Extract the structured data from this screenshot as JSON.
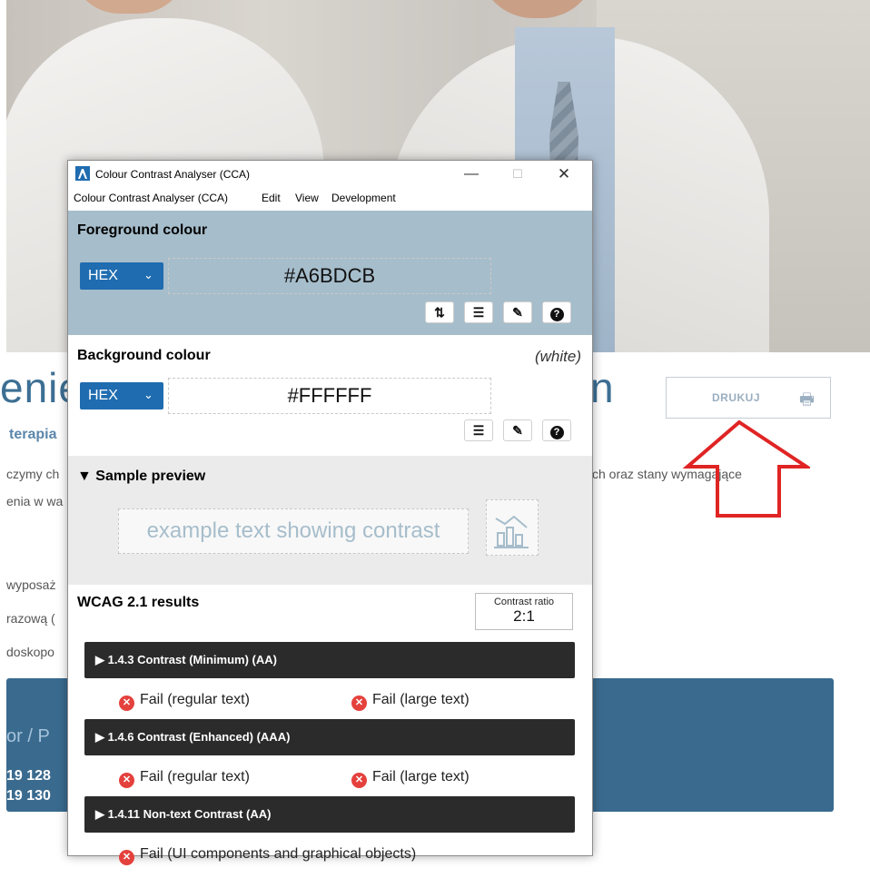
{
  "page": {
    "title_left": "enie",
    "title_right": "n",
    "subtitle": "terapia",
    "lines": [
      "czymy ch",
      "enia w wa",
      "wyposaż",
      "razową (",
      "doskopo"
    ],
    "line_right": "ch oraz stany wymagające",
    "print_button": "DRUKUJ",
    "band_title": "or / P",
    "band_numbers": [
      "19 128",
      "19 130"
    ]
  },
  "cca": {
    "window_title": "Colour Contrast Analyser (CCA)",
    "controls": {
      "minimize": "—",
      "maximize": "☐",
      "close": "✕"
    },
    "menu": [
      "Colour Contrast Analyser (CCA)",
      "Edit",
      "View",
      "Development"
    ],
    "foreground": {
      "heading": "Foreground colour",
      "format": "HEX",
      "value": "#A6BDCB",
      "color": "#A6BDCB",
      "tools": [
        "swap-icon",
        "sliders-icon",
        "eyedropper-icon",
        "help-icon"
      ]
    },
    "background": {
      "heading": "Background colour",
      "name": "(white)",
      "format": "HEX",
      "value": "#FFFFFF",
      "color": "#FFFFFF",
      "tools": [
        "sliders-icon",
        "eyedropper-icon",
        "help-icon"
      ]
    },
    "sample": {
      "heading": "▼ Sample preview",
      "text": "example text showing contrast"
    },
    "results": {
      "heading": "WCAG 2.1 results",
      "ratio_label": "Contrast ratio",
      "ratio_value": "2:1",
      "criteria": [
        {
          "title": "▶ 1.4.3 Contrast (Minimum) (AA)",
          "results": [
            "Fail (regular text)",
            "Fail (large text)"
          ]
        },
        {
          "title": "▶ 1.4.6 Contrast (Enhanced) (AAA)",
          "results": [
            "Fail (regular text)",
            "Fail (large text)"
          ]
        },
        {
          "title": "▶ 1.4.11 Non-text Contrast (AA)",
          "results": [
            "Fail (UI components and graphical objects)"
          ]
        }
      ]
    }
  }
}
